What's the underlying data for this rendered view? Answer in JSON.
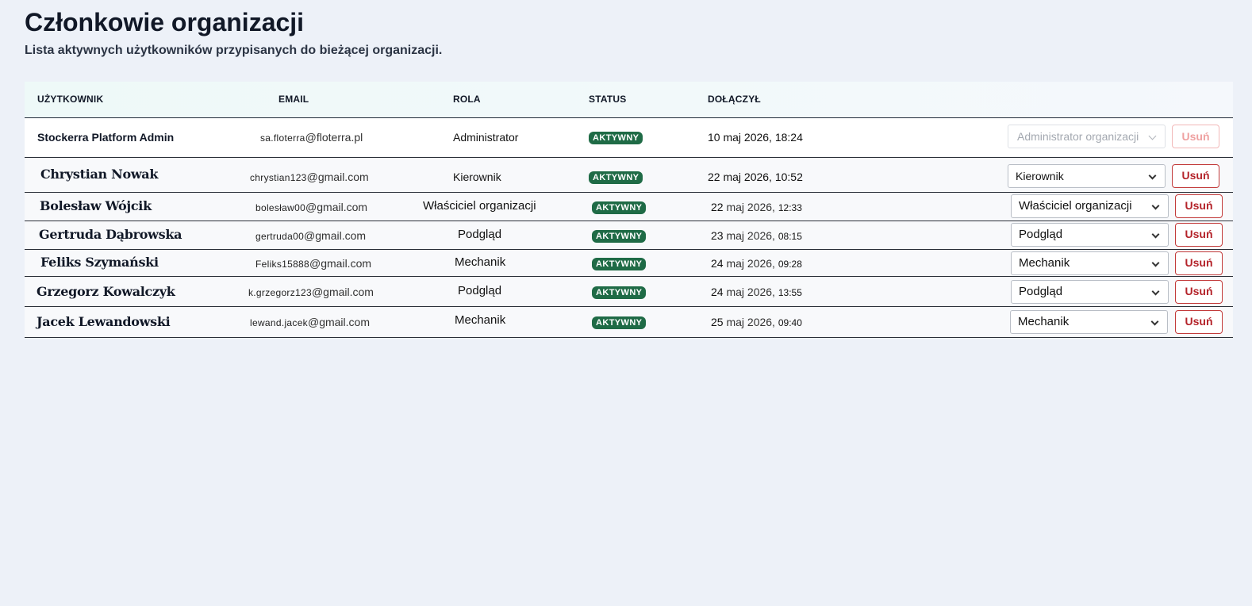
{
  "page": {
    "title": "Członkowie organizacji",
    "subtitle": "Lista aktywnych użytkowników przypisanych do bieżącej organizacji."
  },
  "table": {
    "headers": {
      "user": "UŻYTKOWNIK",
      "email": "EMAIL",
      "role": "ROLA",
      "status": "STATUS",
      "joined": "DOŁĄCZYŁ"
    },
    "rows": [
      {
        "name": "Stockerra Platform Admin",
        "email_local": "sa.floterra",
        "email_domain": "@floterra.pl",
        "role": "Administrator",
        "status": "AKTYWNY",
        "date_day": "10",
        "date_month": "maj 2026,",
        "date_time": "18:24",
        "select_value": "Administrator organizacji",
        "remove_label": "Usuń"
      },
      {
        "name": "Chrystian Nowak",
        "email_local": "chrystian123",
        "email_domain": "@gmail.com",
        "role": "Kierownik",
        "status": "AKTYWNY",
        "date_day": "22",
        "date_month": "maj 2026,",
        "date_time": "10:52",
        "select_value": "Kierownik",
        "remove_label": "Usuń"
      },
      {
        "name": "Bolesław Wójcik",
        "email_local": "bolesław00",
        "email_domain": "@gmail.com",
        "role": "Właściciel organizacji",
        "status": "AKTYWNY",
        "date_day": "22",
        "date_month": "maj 2026,",
        "date_time": "12:33",
        "select_value": "Właściciel organizacji",
        "remove_label": "Usuń"
      },
      {
        "name": "Gertruda Dąbrowska",
        "email_local": "gertruda00",
        "email_domain": "@gmail.com",
        "role": "Podgląd",
        "status": "AKTYWNY",
        "date_day": "23",
        "date_month": "maj 2026,",
        "date_time": "08:15",
        "select_value": "Podgląd",
        "remove_label": "Usuń"
      },
      {
        "name": "Feliks Szymański",
        "email_local": "Feliks15888",
        "email_domain": "@gmail.com",
        "role": "Mechanik",
        "status": "AKTYWNY",
        "date_day": "24",
        "date_month": "maj 2026,",
        "date_time": "09:28",
        "select_value": "Mechanik",
        "remove_label": "Usuń"
      },
      {
        "name": "Grzegorz Kowalczyk",
        "email_local": "k.grzegorz123",
        "email_domain": "@gmail.com",
        "role": "Podgląd",
        "status": "AKTYWNY",
        "date_day": "24",
        "date_month": "maj 2026,",
        "date_time": "13:55",
        "select_value": "Podgląd",
        "remove_label": "Usuń"
      },
      {
        "name": "Jacek Lewandowski",
        "email_local": "lewand.jacek",
        "email_domain": "@gmail.com",
        "role": "Mechanik",
        "status": "AKTYWNY",
        "date_day": "25",
        "date_month": "maj 2026,",
        "date_time": "09:40",
        "select_value": "Mechanik",
        "remove_label": "Usuń"
      }
    ]
  },
  "colors": {
    "background": "#edf1f8",
    "status_badge": "#1f6b46",
    "remove_button": "#b4232a"
  }
}
